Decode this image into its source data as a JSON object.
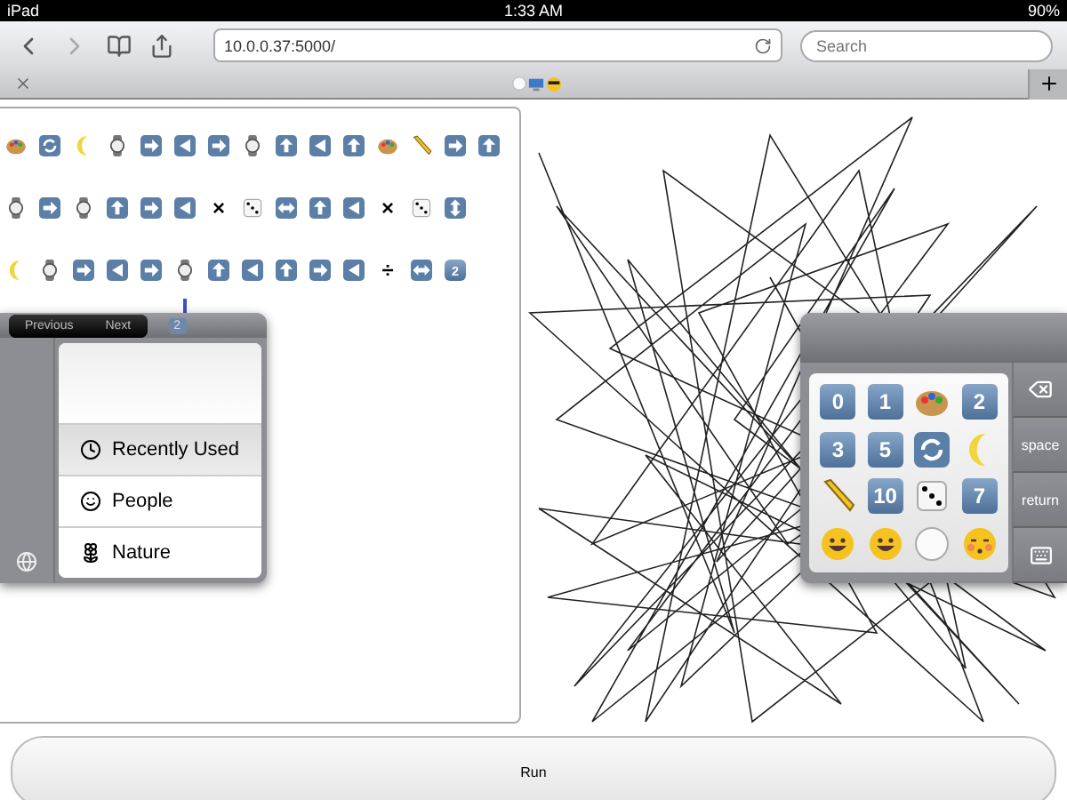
{
  "status_bar": {
    "carrier": "iPad",
    "time": "1:33 AM",
    "battery": "90%"
  },
  "toolbar": {
    "url": "10.0.0.37:5000/",
    "search_placeholder": "Search"
  },
  "editor": {
    "rows": [
      [
        {
          "kind": "palette"
        },
        {
          "kind": "cycle"
        },
        {
          "kind": "moon"
        },
        {
          "kind": "watch"
        },
        {
          "kind": "right"
        },
        {
          "kind": "left"
        },
        {
          "kind": "right"
        },
        {
          "kind": "watch"
        },
        {
          "kind": "up"
        },
        {
          "kind": "left"
        },
        {
          "kind": "up"
        },
        {
          "kind": "palette"
        },
        {
          "kind": "pencil"
        },
        {
          "kind": "right"
        },
        {
          "kind": "up"
        }
      ],
      [
        {
          "kind": "watch"
        },
        {
          "kind": "right"
        },
        {
          "kind": "watch"
        },
        {
          "kind": "up"
        },
        {
          "kind": "right"
        },
        {
          "kind": "left"
        },
        {
          "kind": "symbol",
          "label": "×"
        },
        {
          "kind": "dice"
        },
        {
          "kind": "leftright"
        },
        {
          "kind": "up"
        },
        {
          "kind": "left"
        },
        {
          "kind": "symbol",
          "label": "×"
        },
        {
          "kind": "dice"
        },
        {
          "kind": "updown"
        }
      ],
      [
        {
          "kind": "moon"
        },
        {
          "kind": "watch"
        },
        {
          "kind": "right"
        },
        {
          "kind": "left"
        },
        {
          "kind": "right"
        },
        {
          "kind": "watch"
        },
        {
          "kind": "up"
        },
        {
          "kind": "left"
        },
        {
          "kind": "up"
        },
        {
          "kind": "right"
        },
        {
          "kind": "left"
        },
        {
          "kind": "symbol",
          "label": "÷"
        },
        {
          "kind": "leftright"
        },
        {
          "kind": "keycap",
          "label": "2"
        }
      ]
    ]
  },
  "left_keyboard": {
    "buttons": [
      "Previous",
      "Next"
    ],
    "badge": "2",
    "categories": [
      {
        "label": "Recently Used",
        "kind": "clock",
        "selected": true
      },
      {
        "label": "People",
        "kind": "smile",
        "selected": false
      },
      {
        "label": "Nature",
        "kind": "flower",
        "selected": false
      }
    ]
  },
  "right_keyboard": {
    "keys": [
      {
        "kind": "keycap",
        "label": "0"
      },
      {
        "kind": "keycap",
        "label": "1"
      },
      {
        "kind": "palette"
      },
      {
        "kind": "keycap",
        "label": "2"
      },
      {
        "kind": "keycap",
        "label": "3"
      },
      {
        "kind": "keycap",
        "label": "5"
      },
      {
        "kind": "cycle"
      },
      {
        "kind": "moon"
      },
      {
        "kind": "pencil"
      },
      {
        "kind": "keycap",
        "label": "10"
      },
      {
        "kind": "dice"
      },
      {
        "kind": "keycap",
        "label": "7"
      },
      {
        "kind": "smile"
      },
      {
        "kind": "smile"
      },
      {
        "kind": "circle"
      },
      {
        "kind": "kiss"
      }
    ],
    "side_keys": [
      {
        "kind": "backspace"
      },
      {
        "kind": "text",
        "label": "space"
      },
      {
        "kind": "text",
        "label": "return"
      },
      {
        "kind": "hide"
      }
    ]
  },
  "run_button": "Run"
}
